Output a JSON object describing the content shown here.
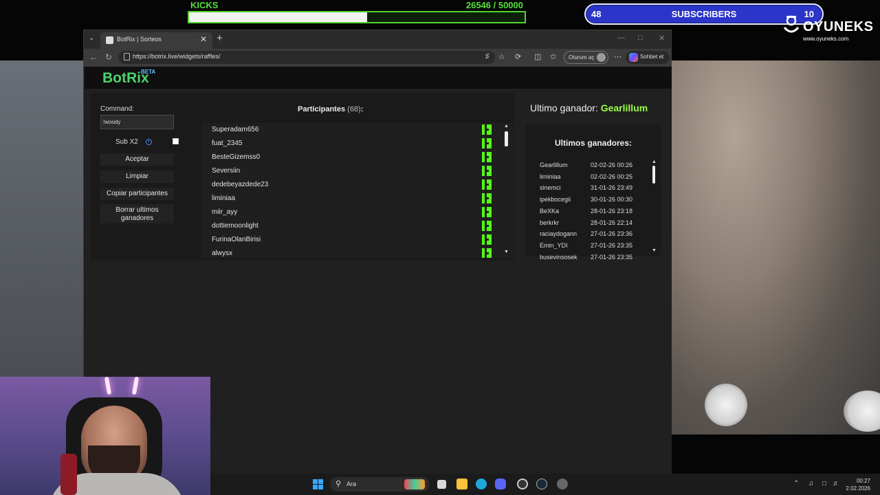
{
  "overlay": {
    "kicks_label": "KICKS",
    "kicks_count": "26546   / 50000",
    "kicks_progress": 0.53,
    "subs_left": "48",
    "subs_label": "SUBSCRIBERS",
    "subs_right": "10",
    "brand_name": "OYUNEKS",
    "brand_url": "www.oyuneks.com",
    "kick_green": "#53fc18",
    "subs_blue": "#2b35c9"
  },
  "browser": {
    "tab_title": "BotRix | Sorteos",
    "url": "https://botrix.live/widgets/raffles/",
    "signin_label": "Oturum aç",
    "copilot_label": "Sohbet et"
  },
  "app": {
    "brand": "BotRix",
    "beta": "BETA",
    "brand_color": "#4bd36b",
    "command_label": "Command:",
    "command_value": "!woody",
    "sub_label": "Sub X2",
    "buttons": {
      "accept": "Aceptar",
      "clear": "Limpiar",
      "copy": "Copiar participantes",
      "delete_winners": "Borrar ultimos ganadores"
    },
    "participants_title": "Participantes",
    "participants_count": "(68)",
    "participants_colon": ":",
    "participants": [
      "Superadam656",
      "fuat_2345",
      "BesteGizemss0",
      "Seversiin",
      "dedebeyazdede23",
      "liminiaa",
      "miir_ayy",
      "dottiemoonlight",
      "FurinaOlanBirisi",
      "alwysx"
    ],
    "last_winner_label": "Ultimo ganador:",
    "last_winner_name": "Gearlillum",
    "winners_title": "Ultimos ganadores:",
    "winners": [
      {
        "name": "Gearlillum",
        "date": "02-02-26 00:26"
      },
      {
        "name": "liminiaa",
        "date": "02-02-26 00:25"
      },
      {
        "name": "sinemci",
        "date": "31-01-26 23:49"
      },
      {
        "name": "ipekbocegii",
        "date": "30-01-26 00:30"
      },
      {
        "name": "BeXKa",
        "date": "28-01-26 23:18"
      },
      {
        "name": "berkrkr",
        "date": "28-01-26 22:14"
      },
      {
        "name": "raciaydogann",
        "date": "27-01-26 23:36"
      },
      {
        "name": "Emin_YDI",
        "date": "27-01-26 23:35"
      },
      {
        "name": "busevinsosek",
        "date": "27-01-26 23:35"
      }
    ]
  },
  "taskbar": {
    "search_placeholder": "Ara",
    "time": "00:27",
    "date": "2.02.2026"
  }
}
